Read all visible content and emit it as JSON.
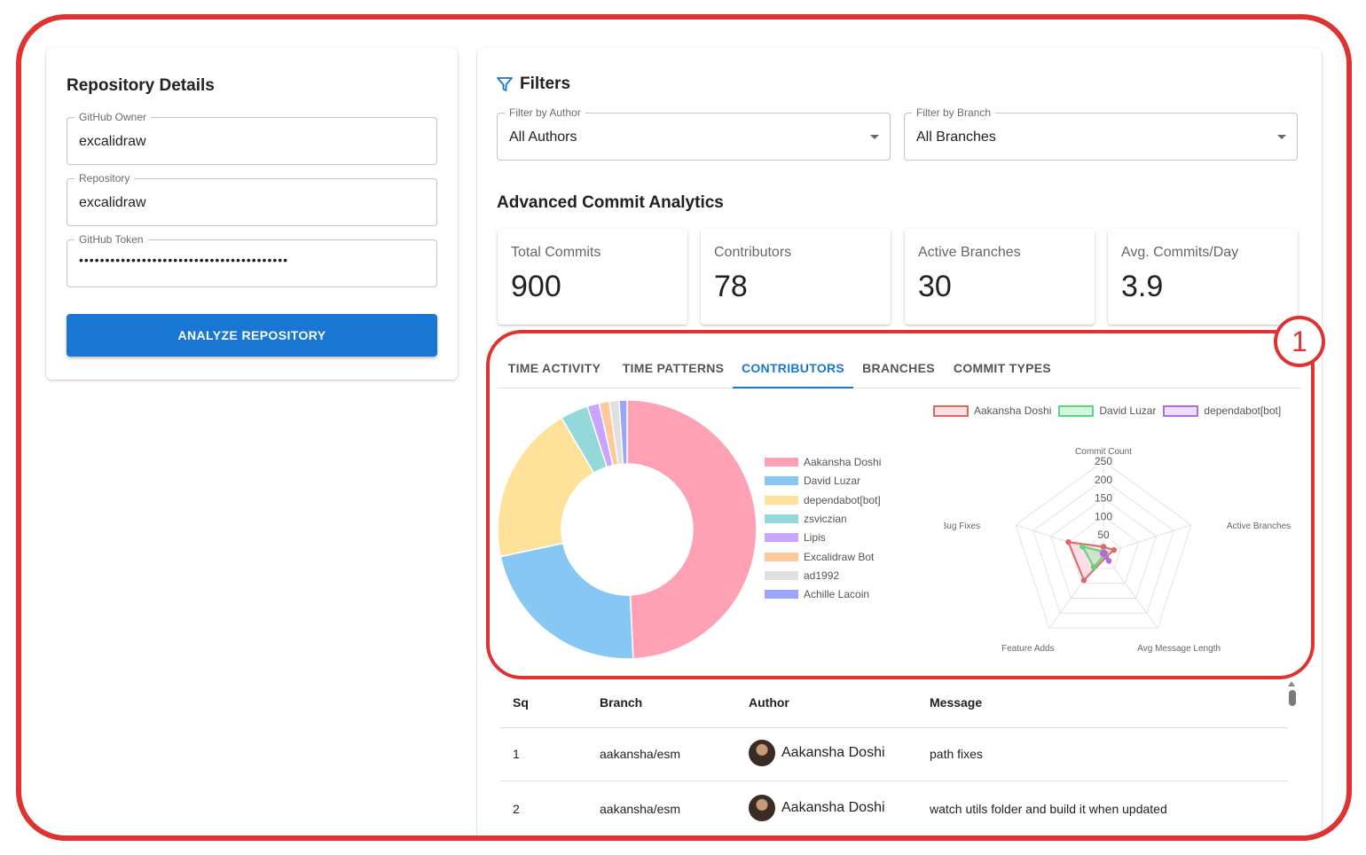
{
  "repository": {
    "title": "Repository Details",
    "owner_label": "GitHub Owner",
    "owner_value": "excalidraw",
    "repo_label": "Repository",
    "repo_value": "excalidraw",
    "token_label": "GitHub Token",
    "token_value": "••••••••••••••••••••••••••••••••••••••••",
    "analyze_button": "ANALYZE REPOSITORY"
  },
  "filters": {
    "title": "Filters",
    "icon": "filter-icon",
    "author_label": "Filter by Author",
    "author_value": "All Authors",
    "branch_label": "Filter by Branch",
    "branch_value": "All Branches"
  },
  "analytics": {
    "title": "Advanced Commit Analytics",
    "stats": [
      {
        "label": "Total Commits",
        "value": "900"
      },
      {
        "label": "Contributors",
        "value": "78"
      },
      {
        "label": "Active Branches",
        "value": "30"
      },
      {
        "label": "Avg. Commits/Day",
        "value": "3.9"
      }
    ]
  },
  "tabs": [
    {
      "label": "TIME ACTIVITY",
      "active": false
    },
    {
      "label": "TIME PATTERNS",
      "active": false
    },
    {
      "label": "CONTRIBUTORS",
      "active": true
    },
    {
      "label": "BRANCHES",
      "active": false
    },
    {
      "label": "COMMIT TYPES",
      "active": false
    }
  ],
  "annotation": {
    "label": "1",
    "color": "#dd3333"
  },
  "chart_data": [
    {
      "type": "pie",
      "variant": "doughnut",
      "categories": [
        "Aakansha Doshi",
        "David Luzar",
        "dependabot[bot]",
        "zsviczian",
        "Lipis",
        "Excalidraw Bot",
        "ad1992",
        "Achille Lacoin"
      ],
      "values": [
        49.5,
        22.5,
        20,
        3.5,
        1.5,
        1.3,
        1.2,
        1.0
      ],
      "colors": [
        "#ffa1b5",
        "#86c7f3",
        "#ffe29a",
        "#93d9d9",
        "#c9a5ff",
        "#ffc99c",
        "#e0e0e0",
        "#9aa5ff"
      ],
      "legend": "right"
    },
    {
      "type": "radar",
      "axes": [
        "Commit Count",
        "Active Branches",
        "Avg Message Length",
        "Feature Adds",
        "Bug Fixes"
      ],
      "r_ticks": [
        "50",
        "100",
        "150",
        "200",
        "250"
      ],
      "r_range": [
        0,
        250
      ],
      "series": [
        {
          "name": "Aakansha Doshi",
          "values": [
            18,
            30,
            12,
            90,
            100
          ],
          "color": "#e06666",
          "fill": "rgba(255,161,181,0.35)"
        },
        {
          "name": "David Luzar",
          "values": [
            5,
            5,
            6,
            45,
            60
          ],
          "color": "#5cd67a",
          "fill": "rgba(130,230,160,0.35)"
        },
        {
          "name": "dependabot[bot]",
          "values": [
            2,
            3,
            25,
            2,
            2
          ],
          "color": "#b36be0",
          "fill": "rgba(200,160,255,0.35)"
        }
      ],
      "legend": "top"
    }
  ],
  "table": {
    "headers": [
      "Sq",
      "Branch",
      "Author",
      "Message"
    ],
    "rows": [
      {
        "sq": "1",
        "branch": "aakansha/esm",
        "author": "Aakansha Doshi",
        "message": "path fixes"
      },
      {
        "sq": "2",
        "branch": "aakansha/esm",
        "author": "Aakansha Doshi",
        "message": "watch utils folder and build it when updated"
      }
    ]
  }
}
